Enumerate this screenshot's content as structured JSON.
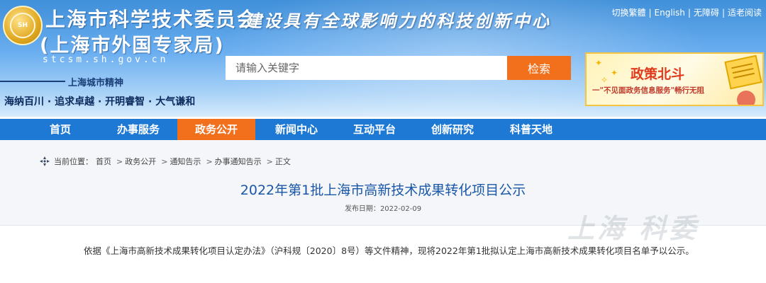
{
  "header": {
    "org_name": "上海市科学技术委员会",
    "org_sub": "(上海市外国专家局)",
    "domain": "stcsm.sh.gov.cn",
    "spirit_label": "上海城市精神",
    "spirit_text": "海纳百川 · 追求卓越 · 开明睿智 · 大气谦和",
    "slogan": "建设具有全球影响力的科技创新中心",
    "emblem_text": "SH"
  },
  "toplinks": {
    "traditional": "切换繁體",
    "english": "English",
    "accessible": "无障碍",
    "elderly": "适老阅读"
  },
  "search": {
    "placeholder": "请输入关键字",
    "button_label": "检索"
  },
  "banner": {
    "title": "政策北斗",
    "subtitle": "一\"不见面政务信息服务\"畅行无阻"
  },
  "nav": {
    "items": [
      {
        "label": "首页"
      },
      {
        "label": "办事服务"
      },
      {
        "label": "政务公开"
      },
      {
        "label": "新闻中心"
      },
      {
        "label": "互动平台"
      },
      {
        "label": "创新研究"
      },
      {
        "label": "科普天地"
      }
    ]
  },
  "breadcrumb": {
    "label": "当前位置：",
    "items": [
      "首页",
      "政务公开",
      "通知告示",
      "办事通知告示",
      "正文"
    ],
    "separator": ">"
  },
  "article": {
    "title": "2022年第1批上海市高新技术成果转化项目公示",
    "date_label": "发布日期：",
    "date_value": "2022-02-09",
    "body": "依据《上海市高新技术成果转化项目认定办法》（沪科规〔2020〕8号）等文件精神，现将2022年第1批拟认定上海市高新技术成果转化项目名单予以公示。",
    "watermark": "上海 科委"
  },
  "colors": {
    "nav_bg": "#1e79d5",
    "nav_active": "#f26f1c",
    "title_color": "#1a57a8",
    "search_button": "#f26f1c"
  }
}
